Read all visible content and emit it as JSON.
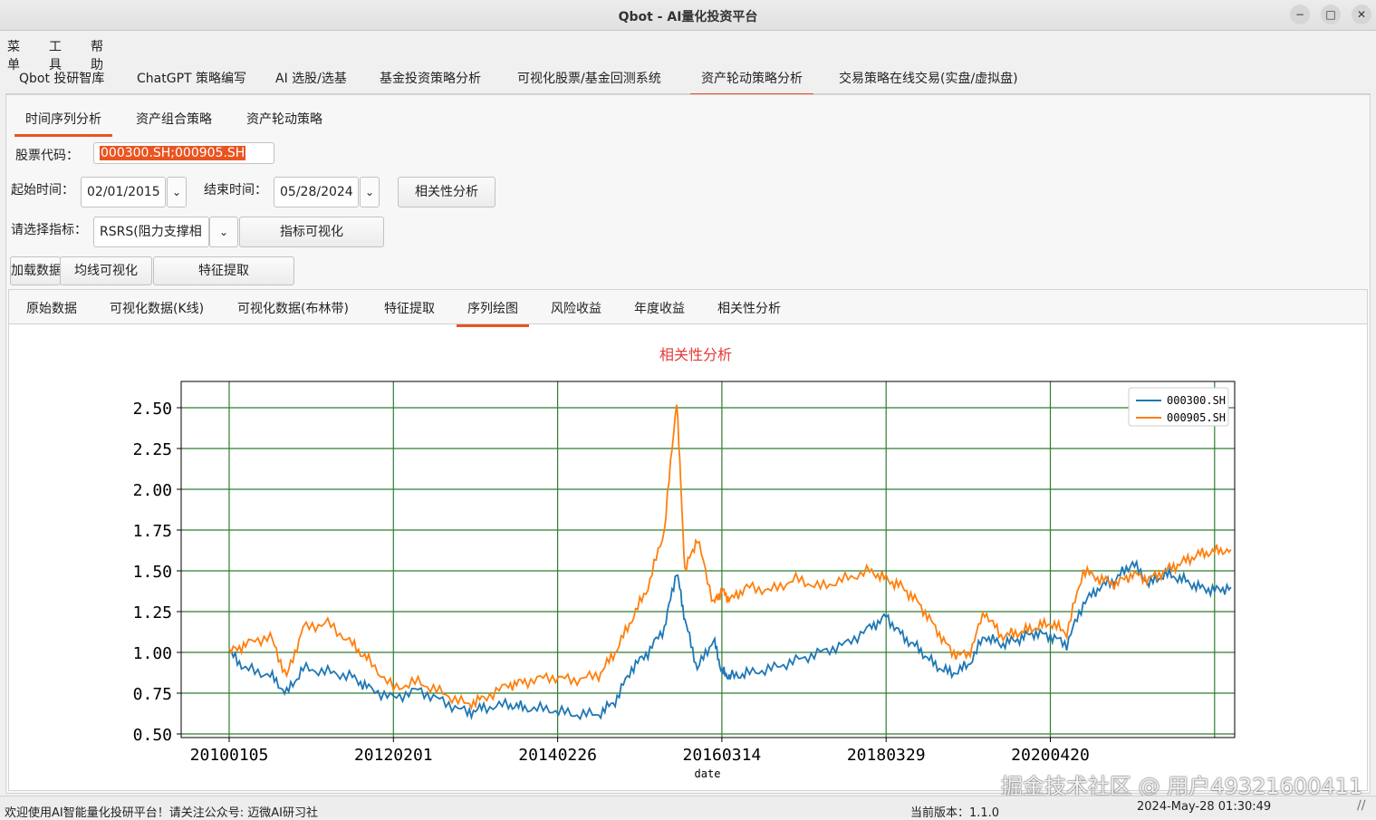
{
  "window": {
    "title": "Qbot - AI量化投资平台",
    "minimize": "−",
    "maximize": "□",
    "close": "✕"
  },
  "menu": [
    "菜单",
    "工具",
    "帮助"
  ],
  "main_tabs": [
    "Qbot 投研智库",
    "ChatGPT 策略编写",
    "AI 选股/选基",
    "基金投资策略分析",
    "可视化股票/基金回测系统",
    "资产轮动策略分析",
    "交易策略在线交易(实盘/虚拟盘)"
  ],
  "sub_tabs": [
    "时间序列分析",
    "资产组合策略",
    "资产轮动策略"
  ],
  "form": {
    "code_label": "股票代码：",
    "code_value": "000300.SH;000905.SH",
    "start_label": "起始时间：",
    "start_value": "02/01/2015",
    "end_label": "结束时间：",
    "end_value": "05/28/2024",
    "corr_button": "相关性分析",
    "indicator_label": "请选择指标：",
    "indicator_value": "RSRS(阻力支撑相",
    "indicator_viz_button": "指标可视化",
    "load_button": "加载数据",
    "ma_button": "均线可视化",
    "feature_button": "特征提取"
  },
  "view_tabs": [
    "原始数据",
    "可视化数据(K线)",
    "可视化数据(布林带)",
    "特征提取",
    "序列绘图",
    "风险收益",
    "年度收益",
    "相关性分析"
  ],
  "icons": {
    "dropdown": "chevron-down-icon",
    "resize": "resize-grip-icon"
  },
  "colors": {
    "accent": "#e95420",
    "series1": "#1f77b4",
    "series2": "#ff7f0e",
    "grid": "#2e7d32",
    "title": "#e53935"
  },
  "chart_data": {
    "type": "line",
    "title": "相关性分析",
    "xlabel": "date",
    "ylabel": "",
    "xticks": [
      "20100105",
      "20120201",
      "20140226",
      "20160314",
      "20180329",
      "20200420"
    ],
    "yticks": [
      "0.50",
      "0.75",
      "1.00",
      "1.25",
      "1.50",
      "1.75",
      "2.00",
      "2.25",
      "2.50"
    ],
    "ylim": [
      0.5,
      2.6
    ],
    "x_years": [
      2010.0,
      2022.3
    ],
    "grid": true,
    "legend": "top-right",
    "series": [
      {
        "name": "000300.SH",
        "color": "#1f77b4",
        "x": [
          2010.0,
          2010.2,
          2010.5,
          2010.7,
          2010.9,
          2011.2,
          2011.5,
          2011.7,
          2012.0,
          2012.3,
          2012.6,
          2012.9,
          2013.1,
          2013.4,
          2013.6,
          2013.9,
          2014.2,
          2014.5,
          2014.7,
          2014.9,
          2015.1,
          2015.3,
          2015.45,
          2015.55,
          2015.7,
          2015.9,
          2016.0,
          2016.1,
          2016.3,
          2016.6,
          2016.9,
          2017.2,
          2017.5,
          2017.8,
          2018.0,
          2018.2,
          2018.4,
          2018.6,
          2018.8,
          2019.0,
          2019.2,
          2019.4,
          2019.6,
          2019.8,
          2020.0,
          2020.2,
          2020.4,
          2020.6,
          2020.8,
          2021.0,
          2021.2,
          2021.4,
          2021.6,
          2021.8,
          2022.0,
          2022.2
        ],
        "values": [
          1.0,
          0.9,
          0.86,
          0.75,
          0.9,
          0.88,
          0.85,
          0.78,
          0.72,
          0.77,
          0.7,
          0.63,
          0.66,
          0.68,
          0.66,
          0.65,
          0.62,
          0.62,
          0.7,
          0.9,
          1.0,
          1.15,
          1.5,
          1.2,
          0.9,
          1.08,
          0.88,
          0.85,
          0.87,
          0.9,
          0.95,
          1.0,
          1.05,
          1.15,
          1.22,
          1.1,
          1.02,
          0.92,
          0.87,
          0.92,
          1.1,
          1.05,
          1.08,
          1.12,
          1.1,
          1.05,
          1.3,
          1.4,
          1.45,
          1.55,
          1.42,
          1.48,
          1.45,
          1.4,
          1.38,
          1.4
        ]
      },
      {
        "name": "000905.SH",
        "color": "#ff7f0e",
        "x": [
          2010.0,
          2010.2,
          2010.5,
          2010.7,
          2010.9,
          2011.2,
          2011.5,
          2011.7,
          2012.0,
          2012.3,
          2012.6,
          2012.9,
          2013.1,
          2013.4,
          2013.6,
          2013.9,
          2014.2,
          2014.5,
          2014.7,
          2014.9,
          2015.1,
          2015.3,
          2015.45,
          2015.55,
          2015.7,
          2015.9,
          2016.0,
          2016.1,
          2016.3,
          2016.6,
          2016.9,
          2017.2,
          2017.5,
          2017.8,
          2018.0,
          2018.2,
          2018.4,
          2018.6,
          2018.8,
          2019.0,
          2019.2,
          2019.4,
          2019.6,
          2019.8,
          2020.0,
          2020.2,
          2020.4,
          2020.6,
          2020.8,
          2021.0,
          2021.2,
          2021.4,
          2021.6,
          2021.8,
          2022.0,
          2022.2
        ],
        "values": [
          1.0,
          1.05,
          1.1,
          0.85,
          1.15,
          1.18,
          1.05,
          0.95,
          0.78,
          0.82,
          0.75,
          0.68,
          0.72,
          0.8,
          0.82,
          0.85,
          0.83,
          0.86,
          1.0,
          1.2,
          1.4,
          1.75,
          2.55,
          1.5,
          1.7,
          1.3,
          1.38,
          1.32,
          1.4,
          1.38,
          1.45,
          1.4,
          1.45,
          1.5,
          1.45,
          1.4,
          1.3,
          1.15,
          1.0,
          0.98,
          1.25,
          1.1,
          1.12,
          1.15,
          1.18,
          1.12,
          1.5,
          1.45,
          1.42,
          1.48,
          1.45,
          1.5,
          1.55,
          1.6,
          1.62,
          1.63
        ]
      }
    ]
  },
  "status": {
    "left": "欢迎使用AI智能量化投研平台！请关注公众号: 迈微AI研习社",
    "version": "当前版本：1.1.0",
    "datetime": "2024-May-28 01:30:49"
  },
  "watermark": "掘金技术社区 @ 用户4932160041​1"
}
